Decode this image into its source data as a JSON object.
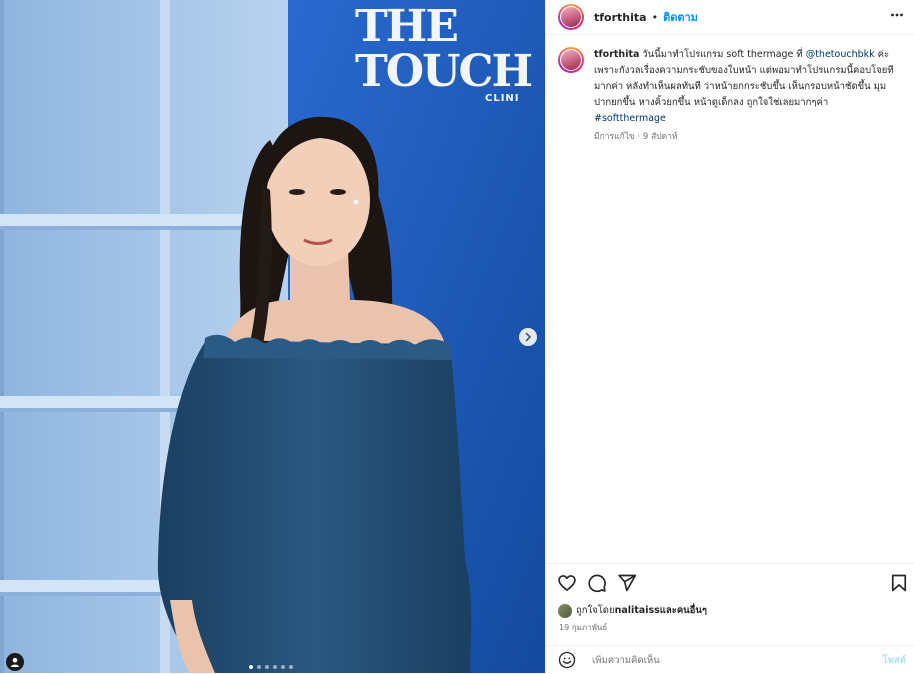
{
  "photo": {
    "brand_line1": "THE",
    "brand_line2": "TOUCH",
    "brand_line3": "CLINI",
    "carousel_dots": 6,
    "active_dot": 0
  },
  "post": {
    "username": "tforthita",
    "separator": "•",
    "follow_label": "ติดตาม",
    "more_label": "•••",
    "caption": {
      "username": "tforthita",
      "text_before": " วันนี้มาทำโปรแกรม soft thermage ที่ ",
      "mention": "@thetouchbkk",
      "text_after": " ค่ะ เพราะกังวลเรื่องความกระชับของใบหน้า แต่พอมาทำโปรแกรมนี้คอบโจยทีมากค่า หลังทำเห็นผลทันที ว่าหน้ายกกระชับขึ้น เห็นกรอบหน้าชัดขึ้น มุมปากยกขึ้น หางคิ้วยกขึ้น หน้าดูเด็กลง ถูกใจใช่เลยมากๆค่า",
      "hashtag": "#softthermage",
      "meta": "มีการแก้ไข · 9 สัปดาห์"
    },
    "likes": {
      "prefix": "ถูกใจโดย ",
      "user": "nalitaiss",
      "suffix": " และคนอื่นๆ"
    },
    "date": "19 กุมภาพันธ์",
    "comment": {
      "placeholder": "เพิ่มความคิดเห็น",
      "post_label": "โพสต์"
    }
  },
  "colors": {
    "accent": "#0095f6",
    "wall_blue": "#1f5fc4",
    "shelf_blue": "#a9c8ea",
    "dress_blue": "#224d73"
  },
  "icons": [
    "heart-icon",
    "comment-icon",
    "share-icon",
    "bookmark-icon",
    "emoji-icon",
    "more-icon",
    "chevron-right-icon",
    "user-tag-icon"
  ]
}
